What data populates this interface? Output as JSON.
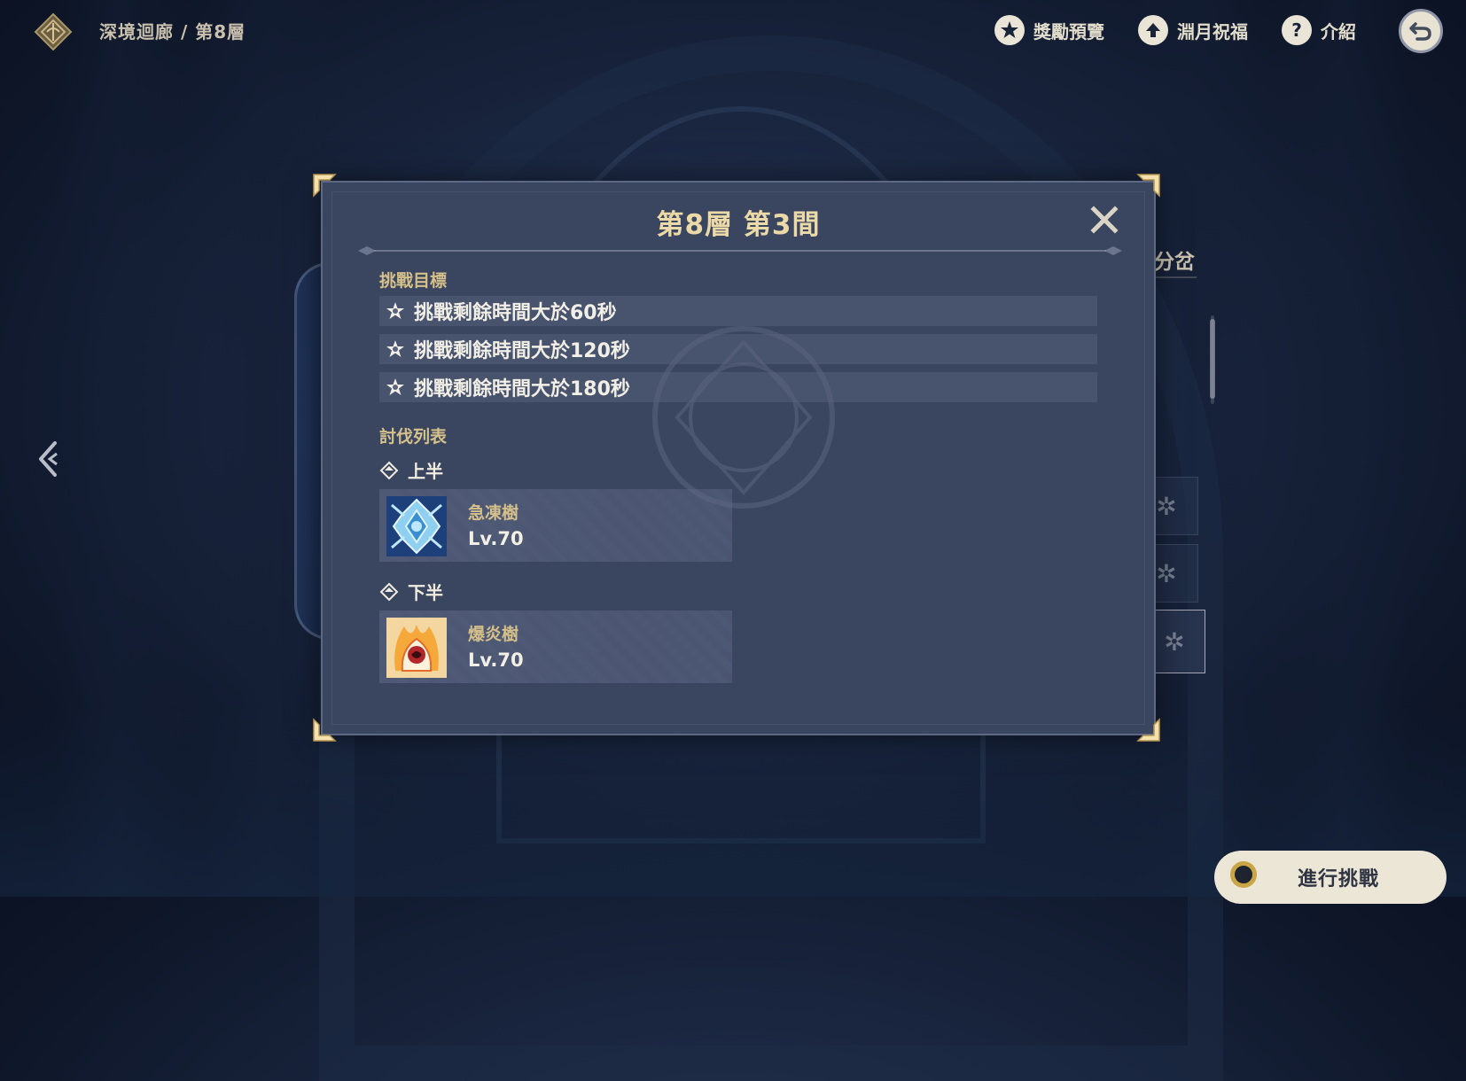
{
  "breadcrumb": "深境迴廊 / 第8層",
  "top_actions": {
    "rewards": "獎勵預覽",
    "blessing": "淵月祝福",
    "intro": "介紹"
  },
  "icons": {
    "logo": "abyss-emblem-icon",
    "rewards": "star-badge-icon",
    "blessing": "up-arrow-circle-icon",
    "intro": "question-circle-icon",
    "back": "return-arrow-icon",
    "close": "close-x-icon"
  },
  "side_panel": {
    "branch_label": "分岔"
  },
  "modal": {
    "title": "第8層 第3間",
    "goals_label": "挑戰目標",
    "goals": [
      "挑戰剩餘時間大於60秒",
      "挑戰剩餘時間大於120秒",
      "挑戰剩餘時間大於180秒"
    ],
    "enemy_list_label": "討伐列表",
    "halves": [
      {
        "label": "上半",
        "enemy_name": "急凍樹",
        "enemy_level": "Lv.70"
      },
      {
        "label": "下半",
        "enemy_name": "爆炎樹",
        "enemy_level": "Lv.70"
      }
    ]
  },
  "challenge_button": "進行挑戰",
  "colors": {
    "accent_gold": "#d6c08a",
    "title_gold": "#ecd9a8",
    "modal_bg": "#3a4560",
    "background": "#1a2640"
  }
}
